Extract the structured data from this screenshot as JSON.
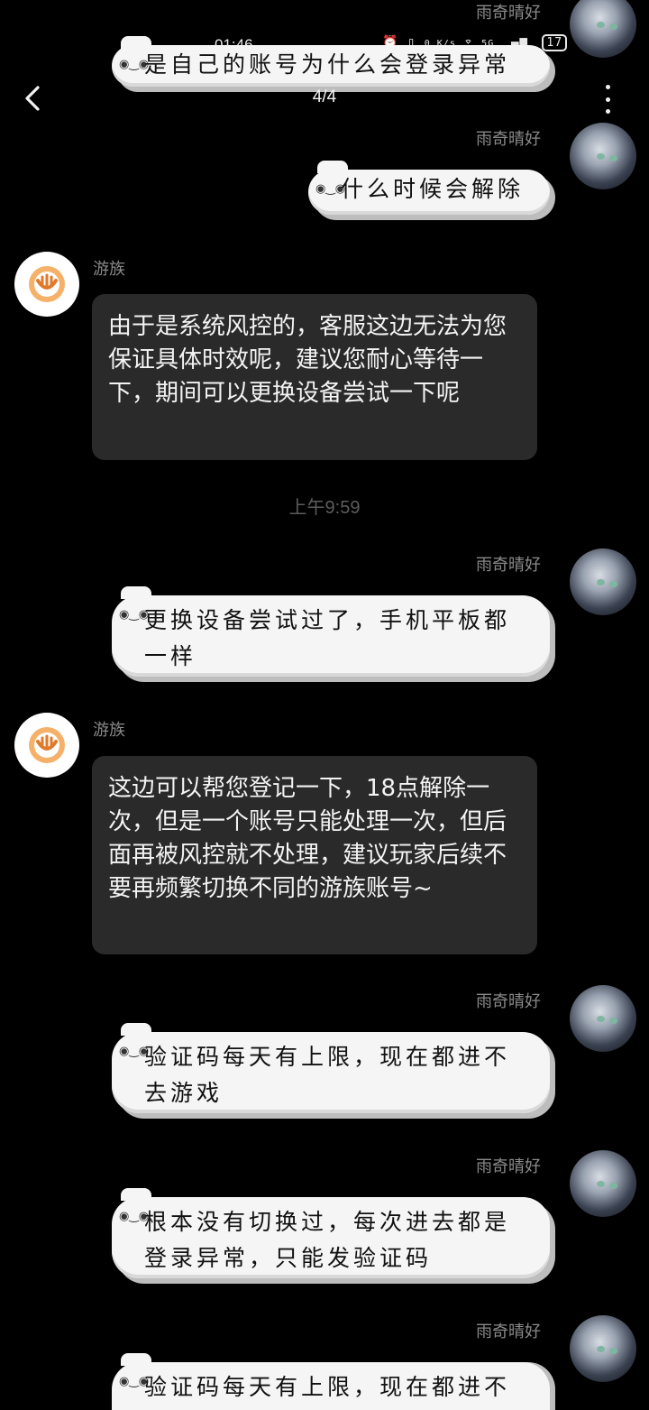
{
  "status_bar": {
    "time": "01:46",
    "network_speed": "0 K/s",
    "signal": "5G",
    "battery": "17"
  },
  "nav": {
    "pager": "4/4"
  },
  "user_name": "雨奇晴好",
  "agent_name": "游族",
  "timestamp": "上午9:59",
  "sticker_face": "◉‿◉",
  "messages": [
    {
      "from": "user",
      "text": "是自己的账号为什么会登录异常"
    },
    {
      "from": "user",
      "text": "什么时候会解除"
    },
    {
      "from": "agent",
      "text": "由于是系统风控的，客服这边无法为您保证具体时效呢，建议您耐心等待一下，期间可以更换设备尝试一下呢"
    },
    {
      "from": "user",
      "text": "更换设备尝试过了，手机平板都一样"
    },
    {
      "from": "agent",
      "text": "这边可以帮您登记一下，18点解除一次，但是一个账号只能处理一次，但后面再被风控就不处理，建议玩家后续不要再频繁切换不同的游族账号~"
    },
    {
      "from": "user",
      "text": "验证码每天有上限，现在都进不去游戏"
    },
    {
      "from": "user",
      "text": "根本没有切换过，每次进去都是登录异常，只能发验证码"
    },
    {
      "from": "user",
      "text": "验证码每天有上限，现在都进不去游戏"
    }
  ]
}
